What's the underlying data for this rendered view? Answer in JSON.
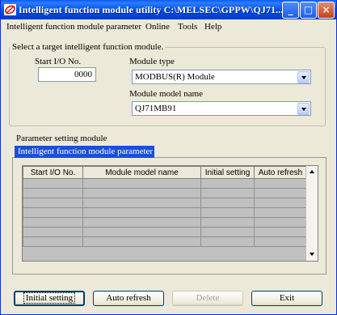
{
  "window": {
    "title": "Intelligent function module utility C:\\MELSEC\\GPPW\\QJ71..."
  },
  "titlebar_buttons": {
    "minimize": "_",
    "maximize": "□",
    "close": "×"
  },
  "menu": [
    {
      "label": "Intelligent function module parameter"
    },
    {
      "label": "Online"
    },
    {
      "label": "Tools"
    },
    {
      "label": "Help"
    }
  ],
  "target_group": {
    "legend": "Select a target intelligent function module.",
    "start_io_label": "Start I/O No.",
    "start_io_value": "0000",
    "module_type_label": "Module type",
    "module_type_value": "MODBUS(R) Module",
    "model_name_label": "Module model name",
    "model_name_value": "QJ71MB91"
  },
  "parameter_section": {
    "heading": "Parameter setting module",
    "tab_label": "Intelligent function module parameter",
    "columns": [
      "Start I/O No.",
      "Module model name",
      "Initial setting",
      "Auto refresh"
    ],
    "row_count": 7
  },
  "buttons": {
    "initial_setting": "Initial setting",
    "auto_refresh": "Auto refresh",
    "delete": "Delete",
    "exit": "Exit"
  },
  "colors": {
    "titlebar": "#0053e8",
    "tab_selected": "#1a50d6",
    "grid_cell": "#c0c0c0",
    "window_bg": "#ece9d8"
  }
}
